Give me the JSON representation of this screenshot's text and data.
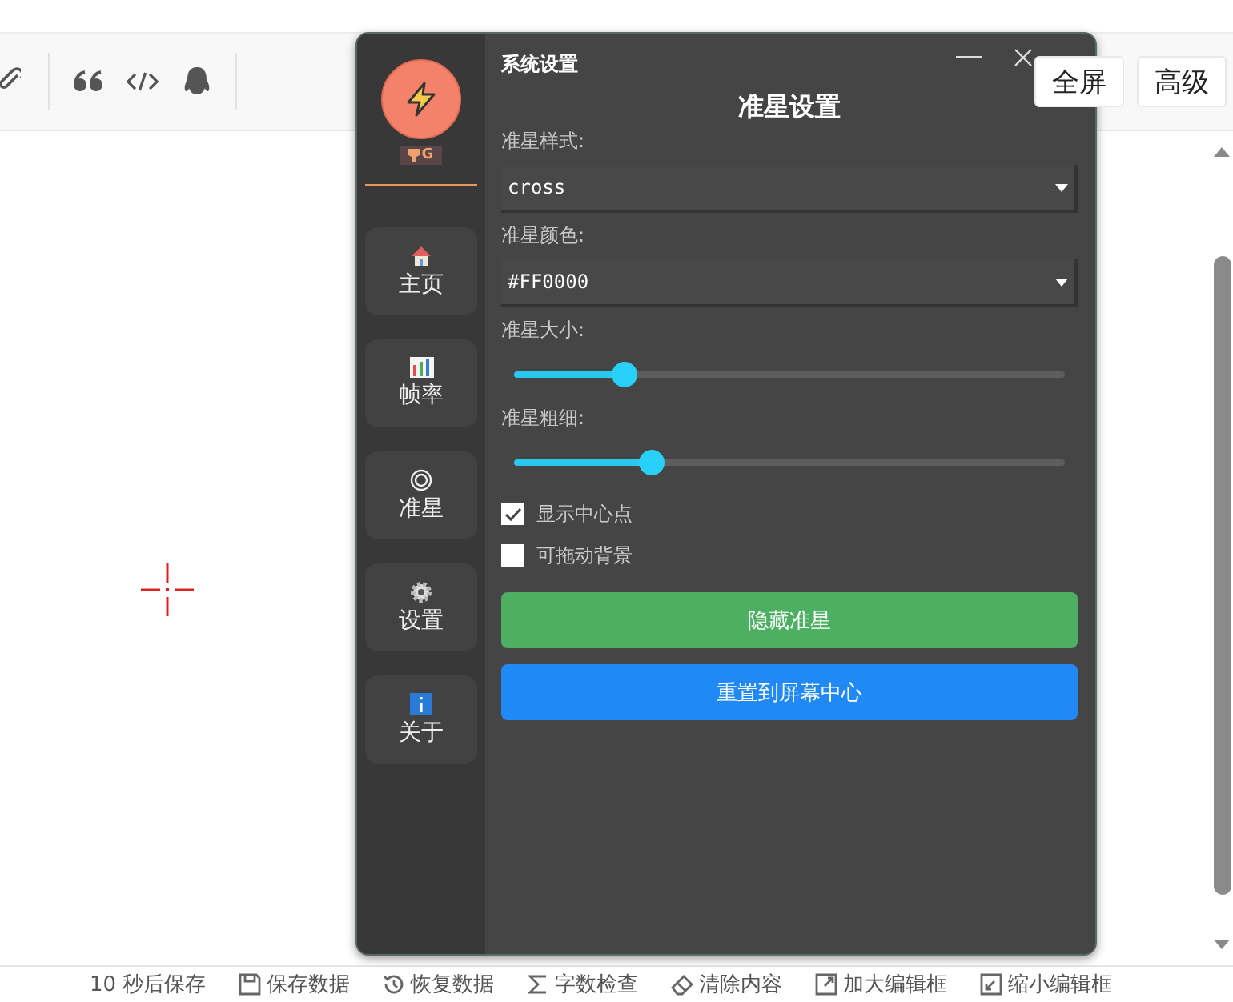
{
  "editor_toolbar": {
    "buttons": [
      {
        "label": "全屏"
      },
      {
        "label": "高级"
      }
    ]
  },
  "status_bar": {
    "items": [
      {
        "label": "10 秒后保存"
      },
      {
        "label": "保存数据"
      },
      {
        "label": "恢复数据"
      },
      {
        "label": "字数检查"
      },
      {
        "label": "清除内容"
      },
      {
        "label": "加大编辑框"
      },
      {
        "label": "缩小编辑框"
      }
    ]
  },
  "dialog": {
    "title": "系统设置",
    "heading": "准星设置",
    "badge": "G",
    "nav": [
      {
        "label": "主页"
      },
      {
        "label": "帧率"
      },
      {
        "label": "准星"
      },
      {
        "label": "设置"
      },
      {
        "label": "关于"
      }
    ],
    "fields": [
      {
        "kind": "select",
        "label": "准星样式:",
        "value": "cross"
      },
      {
        "kind": "select",
        "label": "准星颜色:",
        "value": "#FF0000"
      },
      {
        "kind": "slider",
        "label": "准星大小:",
        "level": 0.2
      },
      {
        "kind": "slider",
        "label": "准星粗细:",
        "level": 0.25
      },
      {
        "kind": "checkbox",
        "label": "显示中心点",
        "checked": true
      },
      {
        "kind": "checkbox",
        "label": "可拖动背景",
        "checked": false
      }
    ],
    "buttons": [
      {
        "label": "隐藏准星",
        "color": "#4caf61"
      },
      {
        "label": "重置到屏幕中心",
        "color": "#2189f5"
      }
    ]
  }
}
